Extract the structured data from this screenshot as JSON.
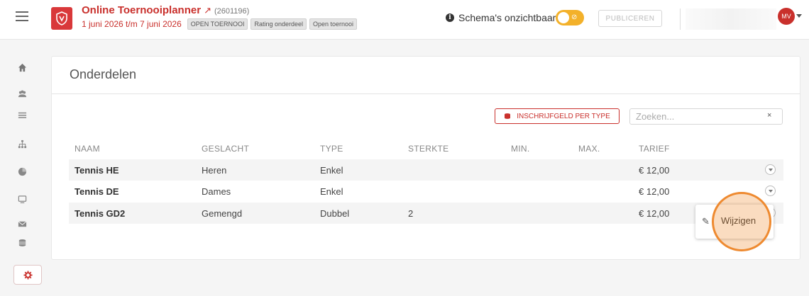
{
  "header": {
    "title": "Online Toernooiplanner",
    "code": "(2601196)",
    "dates": "1 juni 2026 t/m 7 juni 2026",
    "badges": [
      "OPEN TOERNOOI",
      "Rating onderdeel",
      "Open toernooi"
    ],
    "schema_status": "Schema's onzichtbaar",
    "publish_label": "PUBLICEREN",
    "avatar_initials": "MV"
  },
  "sidebar": {
    "items": [
      {
        "icon": "home-icon"
      },
      {
        "icon": "users-icon"
      },
      {
        "icon": "list-icon"
      },
      {
        "icon": "bracket-icon"
      },
      {
        "icon": "pie-chart-icon"
      },
      {
        "icon": "monitor-icon"
      },
      {
        "icon": "mail-icon"
      },
      {
        "icon": "coins-icon"
      },
      {
        "icon": "gear-icon",
        "active": true
      }
    ]
  },
  "main": {
    "title": "Onderdelen",
    "fee_button": "INSCHRIJFGELD PER TYPE",
    "search_placeholder": "Zoeken...",
    "search_clear": "×",
    "columns": [
      "NAAM",
      "GESLACHT",
      "TYPE",
      "STERKTE",
      "MIN.",
      "MAX.",
      "TARIEF"
    ],
    "rows": [
      {
        "naam": "Tennis HE",
        "geslacht": "Heren",
        "type": "Enkel",
        "sterkte": "",
        "min": "",
        "max": "",
        "tarief": "€ 12,00"
      },
      {
        "naam": "Tennis DE",
        "geslacht": "Dames",
        "type": "Enkel",
        "sterkte": "",
        "min": "",
        "max": "",
        "tarief": "€ 12,00"
      },
      {
        "naam": "Tennis GD2",
        "geslacht": "Gemengd",
        "type": "Dubbel",
        "sterkte": "2",
        "min": "",
        "max": "",
        "tarief": "€ 12,00"
      }
    ],
    "popover": {
      "edit_label": "Wijzigen"
    }
  },
  "colors": {
    "accent": "#c9302c",
    "toggle": "#f3b12a",
    "highlight": "#ee8a30"
  }
}
